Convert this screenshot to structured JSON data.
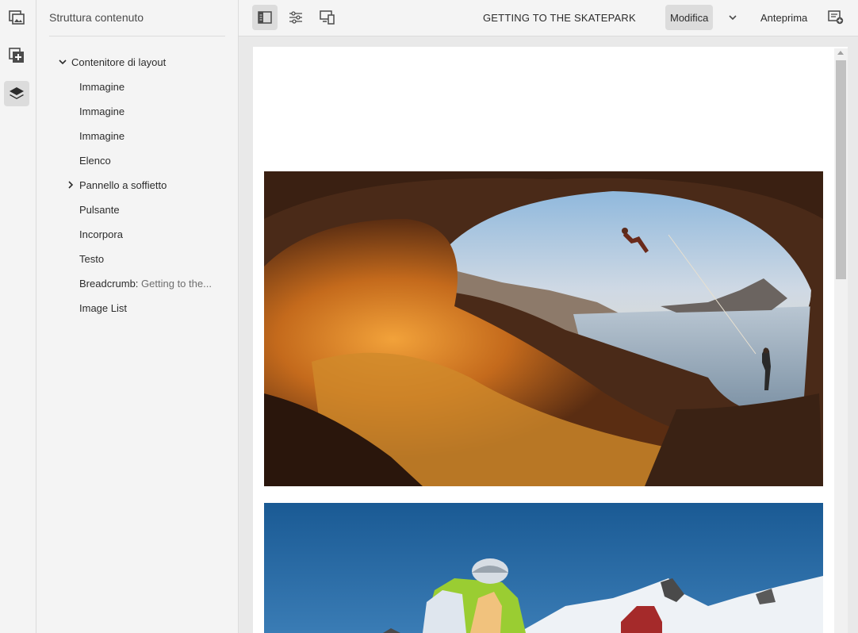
{
  "sidebar": {
    "title": "Struttura contenuto",
    "tree": [
      {
        "label": "Contenitore di layout",
        "expanded": true
      },
      {
        "label": "Immagine"
      },
      {
        "label": "Immagine"
      },
      {
        "label": "Immagine"
      },
      {
        "label": "Elenco"
      },
      {
        "label": "Pannello a soffietto",
        "expandable": true
      },
      {
        "label": "Pulsante"
      },
      {
        "label": "Incorpora"
      },
      {
        "label": "Testo"
      },
      {
        "label": "Breadcrumb:",
        "sub": "Getting to the..."
      },
      {
        "label": "Image List"
      }
    ]
  },
  "toolbar": {
    "page_title": "GETTING TO THE SKATEPARK",
    "edit_label": "Modifica",
    "preview_label": "Anteprima"
  },
  "icons": {
    "rail": [
      "assets-icon",
      "components-icon",
      "layers-icon"
    ],
    "toolbar": [
      "side-panel-toggle-icon",
      "page-properties-icon",
      "emulator-icon",
      "chevron-down-icon",
      "annotate-icon"
    ]
  },
  "colors": {
    "chrome_bg": "#f4f4f4",
    "active_bg": "#dcdcdc",
    "text": "#2c2c2c"
  }
}
